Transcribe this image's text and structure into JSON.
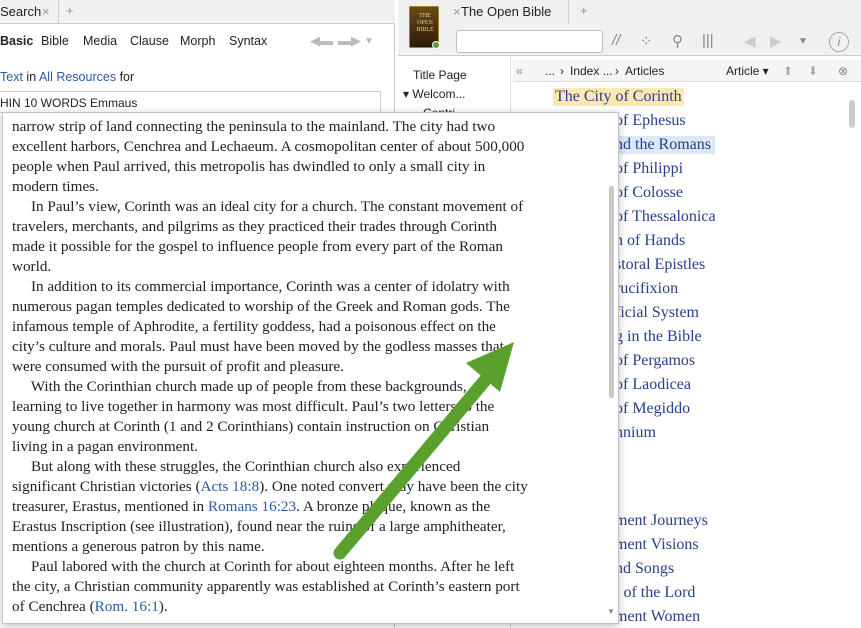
{
  "left_panel": {
    "tab_title": "Search",
    "tab_close": "×",
    "tab_add": "+",
    "search_types": [
      "Basic",
      "Bible",
      "Media",
      "Clause",
      "Morph",
      "Syntax"
    ],
    "scope": {
      "text_link": "Text",
      "in": "in",
      "resources_link": "All Resources",
      "for": "for"
    },
    "query": "HIN 10 WORDS Emmaus"
  },
  "right_panel": {
    "book_cover_text": "THE OPEN BIBLE",
    "tab_title": "The Open Bible",
    "tab_close": "×",
    "tab_add": "+",
    "toolbar_icons": [
      "parallel-icon",
      "visual-filter-icon",
      "search-icon",
      "columns-icon",
      "back-icon",
      "forward-icon",
      "chevron-down-icon",
      "info-icon"
    ],
    "toc": {
      "items": [
        "Title Page",
        "▾ Welcom...",
        "Contri..."
      ]
    },
    "breadcrumb": {
      "collapse": "«",
      "ellipsis": "...",
      "sep1": "›",
      "index": "Index ...",
      "sep2": "›",
      "current": "Articles"
    },
    "article_dropdown": "Article ▾",
    "articles": [
      "The City of Corinth",
      "The City of Ephesus",
      "Paul and the Romans",
      "The City of Philippi",
      "The City of Colosse",
      "The City of Thessalonica",
      "The Laying on of Hands",
      "The Pastoral Epistles",
      "Roman Crucifixion",
      "The Sacrificial System",
      "Anointing in the Bible",
      "The City of Pergamos",
      "The City of Laodicea",
      "The City of Megiddo",
      "The Millennium",
      "",
      "",
      "New Testament Journeys",
      "New Testament Visions",
      "Psalms and Songs",
      "The Angel of the Lord",
      "New Testament Women"
    ],
    "articles_visible": [
      "The City of Corinth",
      "of Ephesus",
      "nd the Romans",
      "of Philippi",
      "of Colosse",
      "of Thessalonica",
      "n of Hands",
      "storal Epistles",
      "rucifixion",
      "ficial System",
      "g in the Bible",
      "of Pergamos",
      "of Laodicea",
      "of Megiddo",
      "nnium",
      "ment Journeys",
      "ment Visions",
      "nd Songs",
      "l of the Lord",
      "ment Women"
    ]
  },
  "popup": {
    "lines": [
      "narrow strip of land connecting the peninsula to the mainland. The city had two",
      "excellent harbors, Cenchrea and Lechaeum. A cosmopolitan center of about 500,000",
      "people when Paul arrived, this metropolis has dwindled to only a small city in",
      "modern times.",
      "     In Paul’s view, Corinth was an ideal city for a church. The constant movement of",
      "travelers, merchants, and pilgrims as they practiced their trades through Corinth",
      "made it possible for the gospel to influence people from every part of the Roman",
      "world.",
      "     In addition to its commercial importance, Corinth was a center of idolatry with",
      "numerous pagan temples dedicated to worship of the Greek and Roman gods. The",
      "infamous temple of Aphrodite, a fertility goddess, had a poisonous effect on the",
      "city’s culture and morals. Paul must have been moved by the godless masses that",
      "were consumed with the pursuit of profit and pleasure.",
      "     With the Corinthian church made up of people from these backgrounds,",
      "learning to live together in harmony was most difficult. Paul’s two letters to the",
      "young church at Corinth (1 and 2 Corinthians) contain instruction on Christian",
      "living in a pagan environment.",
      "     But along with these struggles, the Corinthian church also experienced"
    ],
    "line18_pre": "significant Christian victories (",
    "line18_ref": "Acts 18:8",
    "line18_post": "). One noted convert may have been the city",
    "line19_pre": "treasurer, Erastus, mentioned in ",
    "line19_ref": "Romans 16:23",
    "line19_post": ". A bronze plaque, known as the",
    "line20": "Erastus Inscription (see illustration), found near the ruins of a large amphitheater,",
    "line21": "mentions a generous patron by this name.",
    "line22": "     Paul labored with the church at Corinth for about eighteen months. After he left",
    "line23": "the city, a Christian community apparently was established at Corinth’s eastern port",
    "line24_pre": "of Cenchrea (",
    "line24_ref": "Rom. 16:1",
    "line24_post": ")."
  },
  "colors": {
    "link": "#2a5aa8",
    "article": "#27408b",
    "highlight": "#fde9b0",
    "selected": "#dde8f7",
    "arrow": "#5aa02c"
  }
}
